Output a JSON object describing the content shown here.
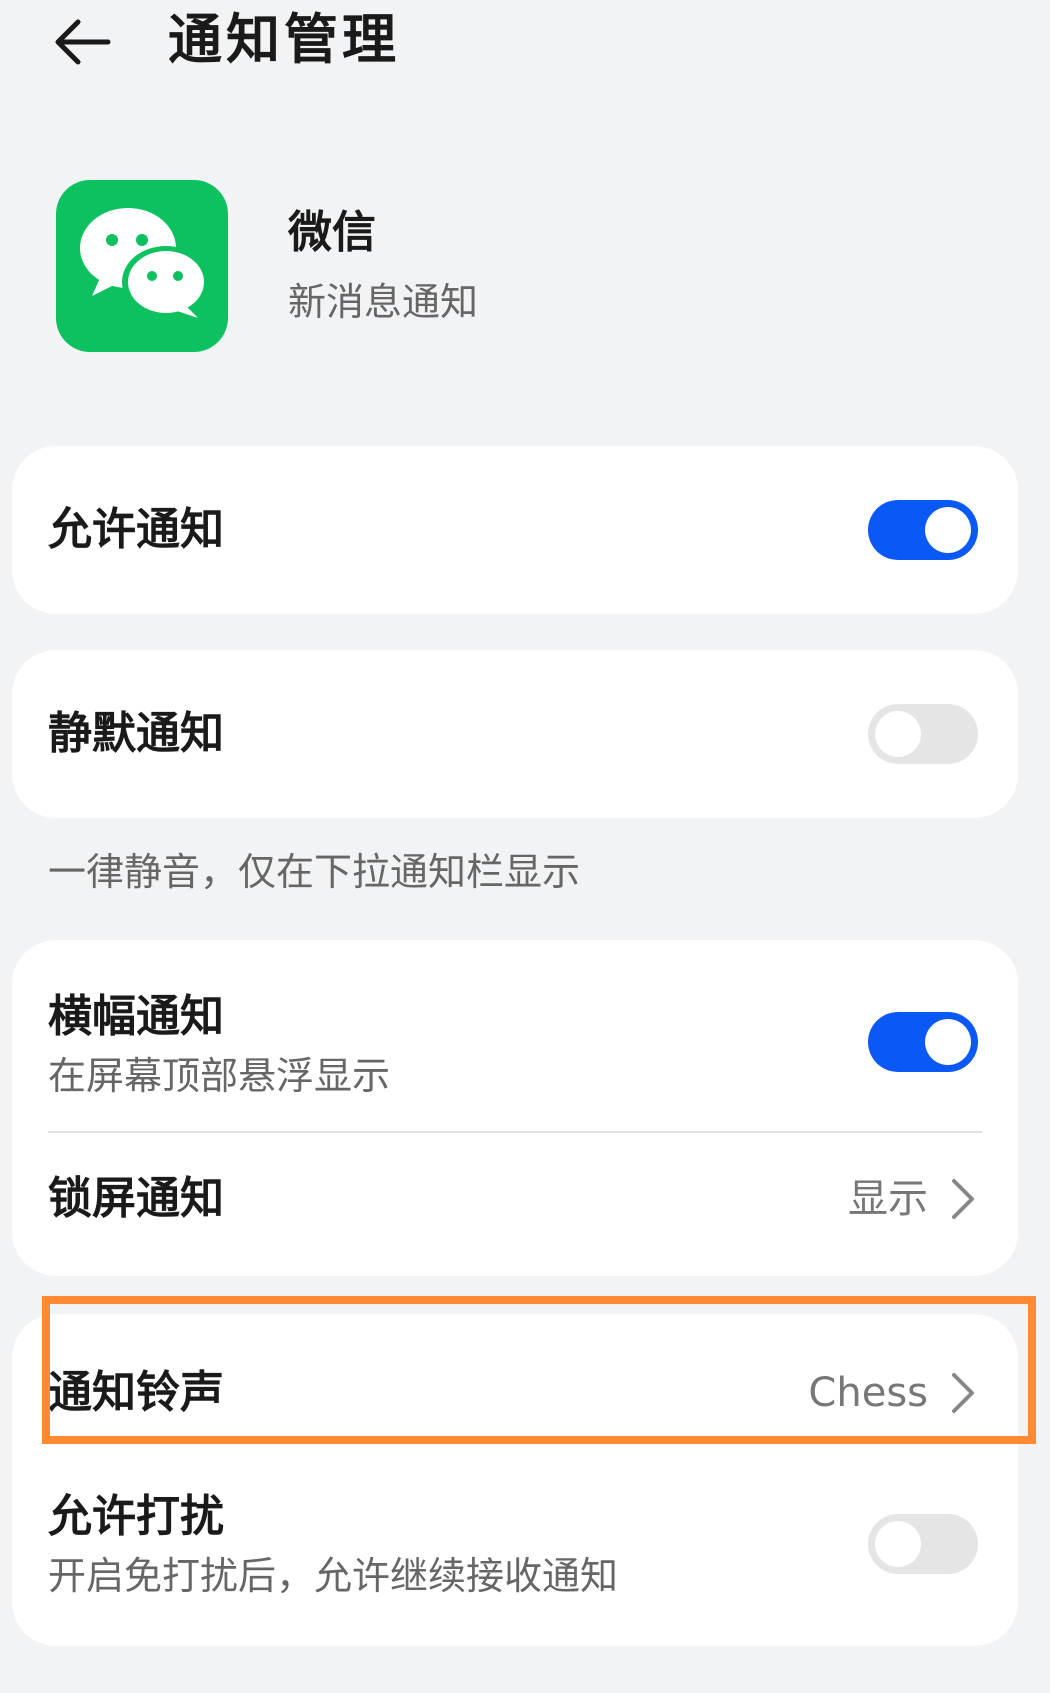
{
  "header": {
    "title": "通知管理",
    "back_icon": "arrow-left-icon"
  },
  "app": {
    "name": "微信",
    "subtitle": "新消息通知",
    "icon": "wechat-icon",
    "icon_color": "#0dc160"
  },
  "settings": {
    "allow_notifications": {
      "label": "允许通知",
      "enabled": true
    },
    "silent_notifications": {
      "label": "静默通知",
      "enabled": false
    },
    "silent_note": "一律静音，仅在下拉通知栏显示",
    "banner_notifications": {
      "label": "横幅通知",
      "description": "在屏幕顶部悬浮显示",
      "enabled": true
    },
    "lock_screen_notifications": {
      "label": "锁屏通知",
      "value": "显示"
    },
    "notification_ringtone": {
      "label": "通知铃声",
      "value": "Chess"
    },
    "allow_disturb": {
      "label": "允许打扰",
      "description": "开启免打扰后，允许继续接收通知",
      "enabled": false
    }
  },
  "colors": {
    "accent": "#0a59f7",
    "highlight": "#ff8a33",
    "background": "#f1f3f5"
  }
}
